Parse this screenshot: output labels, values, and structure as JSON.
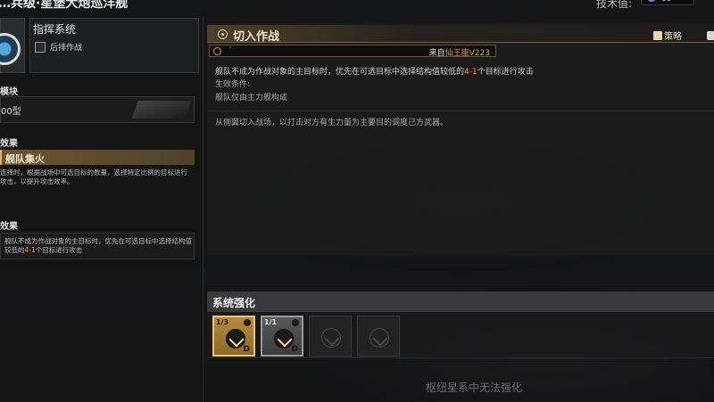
{
  "header": {
    "title": "…兵级·星堡大炮巡洋舰",
    "tech_label": "技术值:",
    "tech_value": "00"
  },
  "left": {
    "system": {
      "title": "指挥系统",
      "sub_label": "后排作战"
    },
    "module": {
      "section": "模块",
      "name": "00型"
    },
    "effect": {
      "section": "效果",
      "name": "舰队集火",
      "description": "选择时，根据战场中可选目标的数量，选择特定比例的目标进行攻击，以提升攻击效率。"
    },
    "effect2": {
      "section": "效果",
      "description_a": "舰队不成为作战对象的主目标时，优先在可选目标中选择结构值较低的",
      "description_hl": "4-1",
      "description_b": "个目标进行攻击"
    }
  },
  "panel": {
    "tab_title": "切入作战",
    "strategy_label": "策略",
    "source_mark": "'",
    "source_prefix": "来自",
    "source_name": "仙王座V223",
    "desc_a": "舰队不成为作战对象的主目标时，优先在可选目标中选择结构值较低的",
    "desc_hl": "4-1",
    "desc_b": "个目标进行攻击",
    "condition_label": "生效条件:",
    "condition_value": "舰队仅由主力舰构成",
    "flavor": "从侧翼切入战场，以打击对方有生力量为主要目的调度己方武器。"
  },
  "enhancement": {
    "title": "系统强化",
    "slots": [
      {
        "count": "1/3",
        "grade": "D",
        "state": "gold",
        "icon": "mountain-arrow-icon"
      },
      {
        "count": "1/1",
        "grade": "D",
        "state": "gray",
        "icon": "burst-icon"
      },
      {
        "count": "",
        "grade": "",
        "state": "locked",
        "icon": "down-arrow-icon"
      },
      {
        "count": "",
        "grade": "",
        "state": "locked",
        "icon": "shield-icon"
      }
    ],
    "empty_message": "枢纽星系中无法强化"
  },
  "colors": {
    "accent": "#e0a14a",
    "gold": "#d8b46b",
    "panel": "#1c1c1d"
  }
}
